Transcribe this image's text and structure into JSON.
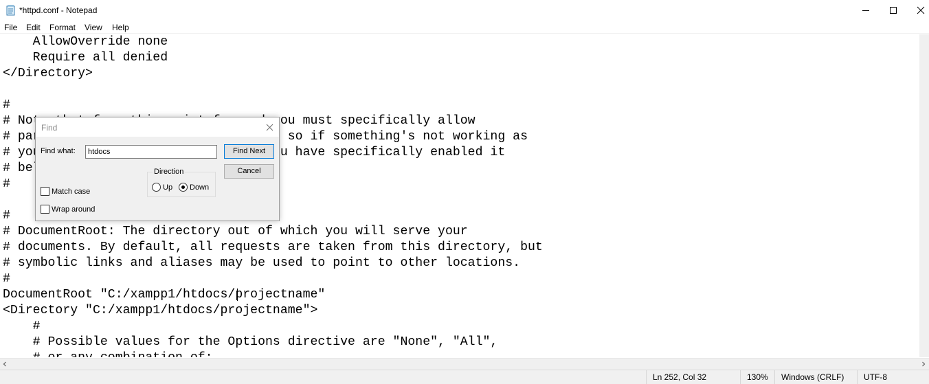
{
  "window": {
    "title": "*httpd.conf - Notepad",
    "controls": {
      "minimize": "minimize-icon",
      "maximize": "maximize-icon",
      "close": "close-icon"
    }
  },
  "menu": [
    "File",
    "Edit",
    "Format",
    "View",
    "Help"
  ],
  "editor": {
    "lines": [
      "    AllowOverride none",
      "    Require all denied",
      "</Directory>",
      "",
      "#",
      "# Note that from this point forward you must specifically allow",
      "# particular features to be enabled - so if something's not working as",
      "# you might expect, make sure that you have specifically enabled it",
      "# below.",
      "#",
      "",
      "#",
      "# DocumentRoot: The directory out of which you will serve your",
      "# documents. By default, all requests are taken from this directory, but",
      "# symbolic links and aliases may be used to point to other locations.",
      "#",
      "DocumentRoot \"C:/xampp1/htdocs/projectname\"",
      "<Directory \"C:/xampp1/htdocs/projectname\">",
      "    #",
      "    # Possible values for the Options directive are \"None\", \"All\",",
      "    # or any combination of:"
    ]
  },
  "status": {
    "position": "Ln 252, Col 32",
    "zoom": "130%",
    "line_ending": "Windows (CRLF)",
    "encoding": "UTF-8"
  },
  "find_dialog": {
    "title": "Find",
    "find_what_label": "Find what:",
    "find_what_value": "htdocs",
    "find_next_label": "Find Next",
    "cancel_label": "Cancel",
    "direction_label": "Direction",
    "up_label": "Up",
    "down_label": "Down",
    "direction_selected": "Down",
    "match_case_label": "Match case",
    "match_case_checked": false,
    "wrap_around_label": "Wrap around",
    "wrap_around_checked": false
  }
}
